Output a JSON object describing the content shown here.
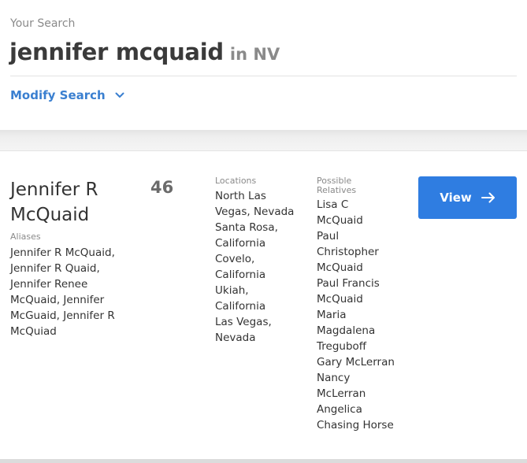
{
  "search": {
    "label": "Your Search",
    "query_name": "jennifer mcquaid",
    "query_location": "in NV",
    "modify_label": "Modify Search"
  },
  "result": {
    "name_line1": "Jennifer R",
    "name_line2": "McQuaid",
    "age": "46",
    "aliases_label": "Aliases",
    "aliases_lines": [
      "Jennifer R McQuaid,",
      "Jennifer R Quaid,",
      "Jennifer Renee",
      "McQuaid, Jennifer",
      "McGuaid, Jennifer R",
      "McQuiad"
    ],
    "locations_label": "Locations",
    "locations_lines": [
      "North Las",
      "Vegas, Nevada",
      "Santa Rosa,",
      "California",
      "Covelo,",
      "California",
      "Ukiah,",
      "California",
      "Las Vegas,",
      "Nevada"
    ],
    "relatives_label_line1": "Possible",
    "relatives_label_line2": "Relatives",
    "relatives_lines": [
      "Lisa C",
      "McQuaid",
      "Paul",
      "Christopher",
      "McQuaid",
      "Paul Francis",
      "McQuaid",
      "Maria",
      "Magdalena",
      "Treguboff",
      "Gary McLerran",
      "Nancy",
      "McLerran",
      "Angelica",
      "Chasing Horse"
    ],
    "view_label": "View"
  },
  "colors": {
    "accent": "#2f7de1",
    "link": "#3a7fd0",
    "muted": "#8a8a8a",
    "text": "#333333"
  },
  "icons": {
    "modify": "chevron-down-icon",
    "view": "arrow-right-icon"
  }
}
